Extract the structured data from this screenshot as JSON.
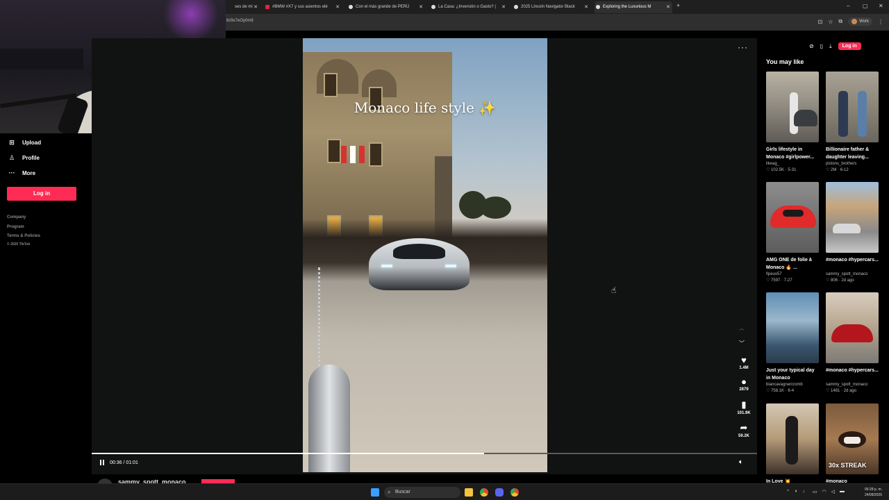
{
  "browser": {
    "tabs": [
      {
        "title": "ses de mi",
        "active": false
      },
      {
        "title": "#BMW #X7 y sus asientos elé",
        "active": false
      },
      {
        "title": "Con el más grande de PERÚ",
        "active": false
      },
      {
        "title": "La Casa: ¿Inversión o Gasto? |",
        "active": false
      },
      {
        "title": "2025 Lincoln Navigator Black",
        "active": false
      },
      {
        "title": "Exploring the Luxurious M",
        "active": true
      }
    ],
    "address": "8z9s7eOy0m8",
    "profile_label": "Work"
  },
  "sidebar": {
    "items": [
      {
        "label": "Upload",
        "icon": "plus-square-icon"
      },
      {
        "label": "Profile",
        "icon": "person-icon"
      },
      {
        "label": "More",
        "icon": "ellipsis-icon"
      }
    ],
    "login_label": "Log in",
    "footer": [
      "Company",
      "Program",
      "Terms & Policies",
      "© 2025 TikTok"
    ]
  },
  "video": {
    "caption": "Monaco life style",
    "caption_emoji": "✨",
    "time": "00:36 / 01:01",
    "progress": 0.59,
    "author": "sammy_spott_monaco",
    "likes": "1.4M",
    "comments": "2879",
    "saves": "101.9K",
    "shares": "59.2K"
  },
  "right_panel": {
    "login_label": "Log in",
    "title": "You may like",
    "cards": [
      {
        "title": "Girls lifestyle in Monaco #girlpower...",
        "author": "likeag_",
        "meta": "♡ 102.5K · 5-31"
      },
      {
        "title": "Billionaire father & daughter leaving...",
        "author": "pistons_brothers",
        "meta": "♡ 2M · 6-12"
      },
      {
        "title": "AMG ONE de folie à Monaco 🔥 ...",
        "author": "fipeux57",
        "meta": "♡ 7597 · 7-27"
      },
      {
        "title": "#monaco #hypercars...",
        "author": "sammy_spott_monaco",
        "meta": "♡ 806 · 2d ago"
      },
      {
        "title": "Just your typical day in Monaco",
        "author": "biancavagnercromb",
        "meta": "♡ 758.1K · 6-4"
      },
      {
        "title": "#monaco #hypercars...",
        "author": "sammy_spott_monaco",
        "meta": "♡ 1481 · 2d ago"
      },
      {
        "title": "In Love 💥",
        "author": "",
        "meta": ""
      },
      {
        "title": "#monaco",
        "author": "",
        "meta": "",
        "badge": "30x STREAK"
      }
    ]
  },
  "taskbar": {
    "search_placeholder": "Buscar",
    "time": "06:28 p. m.",
    "date": "24/08/2025"
  },
  "colors": {
    "accent": "#fe2c55",
    "background": "#000000",
    "player_bg": "#111312"
  }
}
